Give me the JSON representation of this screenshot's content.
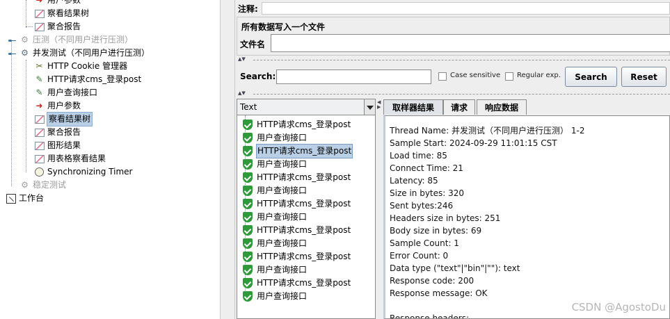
{
  "left_tree": {
    "nodes": [
      {
        "label": "用户参数",
        "icon": "arrow-icon",
        "disabled": false,
        "selected": false
      },
      {
        "label": "察看结果树",
        "icon": "chart-icon",
        "disabled": false,
        "selected": false
      },
      {
        "label": "聚合报告",
        "icon": "chart-icon",
        "disabled": false,
        "selected": false
      },
      {
        "label": "压测（不同用户进行压测）",
        "icon": "gear-icon",
        "disabled": true,
        "selected": false
      },
      {
        "label": "并发测试（不同用户进行压测）",
        "icon": "gear-icon",
        "disabled": false,
        "selected": false
      },
      {
        "label": "HTTP Cookie 管理器",
        "icon": "wrench-icon",
        "disabled": false,
        "selected": false
      },
      {
        "label": "HTTP请求cms_登录post",
        "icon": "pen-icon",
        "disabled": false,
        "selected": false
      },
      {
        "label": "用户查询接口",
        "icon": "pen-icon",
        "disabled": false,
        "selected": false
      },
      {
        "label": "用户参数",
        "icon": "arrow-icon",
        "disabled": false,
        "selected": false
      },
      {
        "label": "察看结果树",
        "icon": "chart-icon",
        "disabled": false,
        "selected": true
      },
      {
        "label": "聚合报告",
        "icon": "chart-icon",
        "disabled": false,
        "selected": false
      },
      {
        "label": "图形结果",
        "icon": "chart-icon",
        "disabled": false,
        "selected": false
      },
      {
        "label": "用表格察看结果",
        "icon": "chart-icon",
        "disabled": false,
        "selected": false
      },
      {
        "label": "Synchronizing Timer",
        "icon": "timer-icon",
        "disabled": false,
        "selected": false
      },
      {
        "label": "稳定测试",
        "icon": "gear-icon",
        "disabled": true,
        "selected": false
      },
      {
        "label": "工作台",
        "icon": "workbench-icon",
        "disabled": false,
        "selected": false
      }
    ]
  },
  "right_panel": {
    "comment_label": "注释:",
    "comment_value": "",
    "file_group_title": "所有数据写入一个文件",
    "file_label": "文件名",
    "file_value": "",
    "search": {
      "label": "Search:",
      "value": "",
      "case_sensitive_label": "Case sensitive",
      "regex_label": "Regular exp.",
      "search_button": "Search",
      "reset_button": "Reset"
    },
    "renderer": {
      "selected": "Text"
    },
    "results": [
      {
        "label": "HTTP请求cms_登录post",
        "selected": false
      },
      {
        "label": "用户查询接口",
        "selected": false
      },
      {
        "label": "HTTP请求cms_登录post",
        "selected": true
      },
      {
        "label": "用户查询接口",
        "selected": false
      },
      {
        "label": "HTTP请求cms_登录post",
        "selected": false
      },
      {
        "label": "用户查询接口",
        "selected": false
      },
      {
        "label": "HTTP请求cms_登录post",
        "selected": false
      },
      {
        "label": "用户查询接口",
        "selected": false
      },
      {
        "label": "HTTP请求cms_登录post",
        "selected": false
      },
      {
        "label": "用户查询接口",
        "selected": false
      },
      {
        "label": "HTTP请求cms_登录post",
        "selected": false
      },
      {
        "label": "用户查询接口",
        "selected": false
      },
      {
        "label": "HTTP请求cms_登录post",
        "selected": false
      },
      {
        "label": "用户查询接口",
        "selected": false
      }
    ],
    "tabs": [
      {
        "label": "取样器结果",
        "active": true
      },
      {
        "label": "请求",
        "active": false
      },
      {
        "label": "响应数据",
        "active": false
      }
    ],
    "sampler_result": [
      "Thread Name: 并发测试（不同用户进行压测） 1-2",
      "Sample Start: 2024-09-29 11:01:15 CST",
      "Load time: 85",
      "Connect Time: 21",
      "Latency: 85",
      "Size in bytes: 320",
      "Sent bytes:246",
      "Headers size in bytes: 251",
      "Body size in bytes: 69",
      "Sample Count: 1",
      "Error Count: 0",
      "Data type (\"text\"|\"bin\"|\"\"): text",
      "Response code: 200",
      "Response message: OK",
      "",
      "Response headers:"
    ]
  },
  "watermark": "CSDN @AgostoDu"
}
